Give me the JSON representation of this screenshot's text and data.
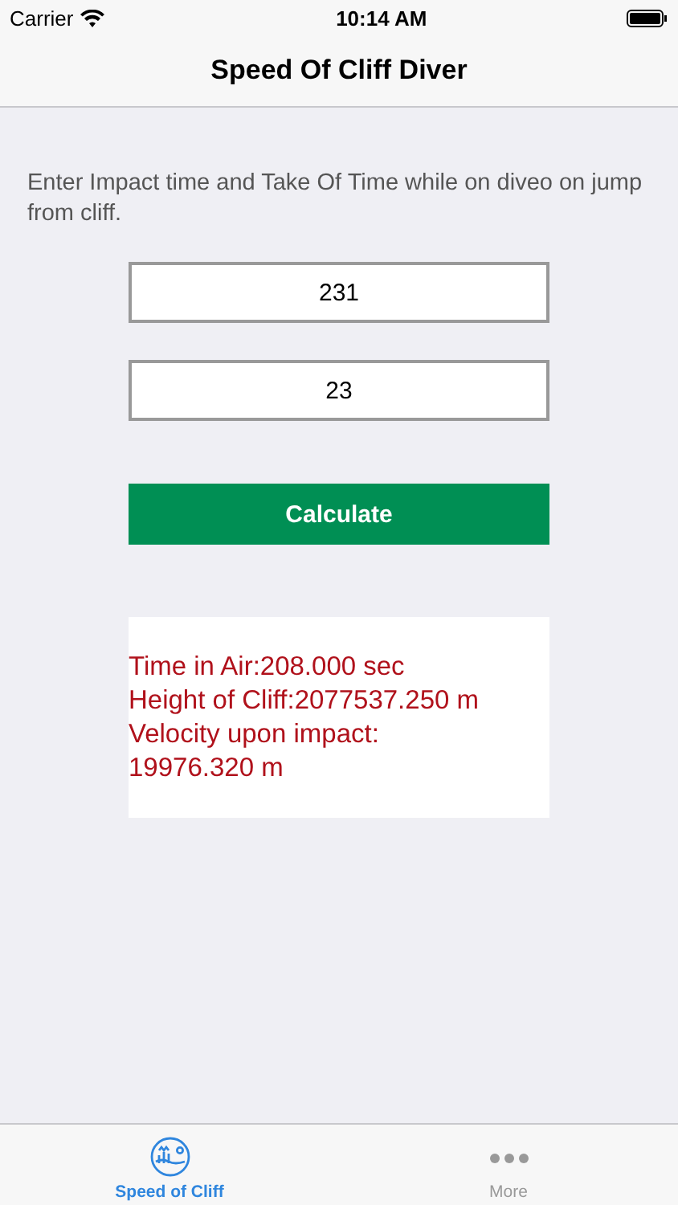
{
  "status_bar": {
    "carrier": "Carrier",
    "time": "10:14 AM"
  },
  "nav": {
    "title": "Speed Of Cliff Diver"
  },
  "instructions": "Enter Impact time and Take Of Time while on diveo on jump from cliff.",
  "fields": [
    {
      "value": "231"
    },
    {
      "value": "23"
    }
  ],
  "button": "Calculate",
  "results": [
    "Time in Air:208.000 sec",
    "Height of Cliff:2077537.250 m",
    "Velocity upon impact:",
    "19976.320 m"
  ],
  "tabs": [
    {
      "kind": "diver",
      "label": "Speed of Cliff",
      "selected": true
    },
    {
      "kind": "more",
      "label": "More",
      "selected": false
    }
  ]
}
